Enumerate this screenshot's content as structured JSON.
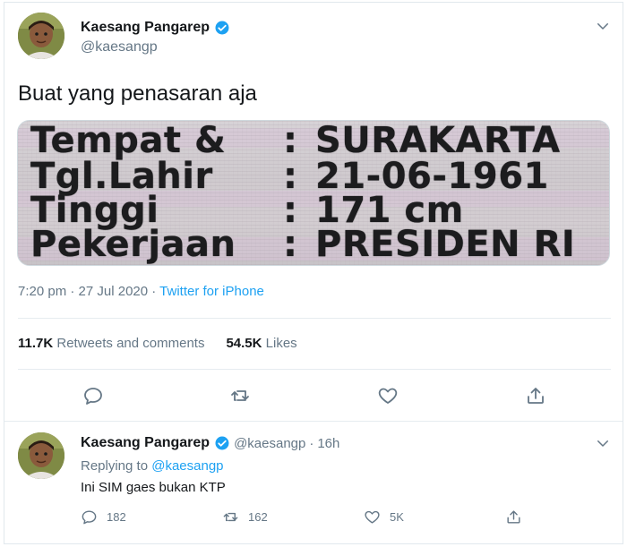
{
  "colors": {
    "accent": "#1da1f2",
    "text_primary": "#14171a",
    "text_secondary": "#657786",
    "divider": "#e6ecf0"
  },
  "main_tweet": {
    "author": {
      "display_name": "Kaesang Pangarep",
      "handle": "@kaesangp",
      "verified_icon": "verified-badge-icon",
      "avatar": "profile-photo"
    },
    "menu_icon": "chevron-down-icon",
    "text": "Buat yang penasaran aja",
    "media": {
      "rows": [
        {
          "label": "Tempat &",
          "colon": ":",
          "value": "SURAKARTA"
        },
        {
          "label": "Tgl.Lahir",
          "colon": ":",
          "value": "21-06-1961"
        },
        {
          "label": "Tinggi",
          "colon": ":",
          "value": "171 cm"
        },
        {
          "label": "Pekerjaan",
          "colon": ":",
          "value": "PRESIDEN RI"
        }
      ]
    },
    "timestamp": "7:20 pm · 27 Jul 2020 · ",
    "source": "Twitter for iPhone",
    "stats": {
      "retweets_count": "11.7K",
      "retweets_label": "Retweets and comments",
      "likes_count": "54.5K",
      "likes_label": "Likes"
    },
    "actions": [
      "reply-icon",
      "retweet-icon",
      "like-icon",
      "share-icon"
    ]
  },
  "reply_tweet": {
    "author": {
      "display_name": "Kaesang Pangarep",
      "handle": "@kaesangp",
      "separator": "·",
      "time": "16h"
    },
    "replying_prefix": "Replying to ",
    "replying_to": "@kaesangp",
    "text": "Ini SIM gaes bukan KTP",
    "counts": {
      "replies": "182",
      "retweets": "162",
      "likes": "5K"
    }
  }
}
